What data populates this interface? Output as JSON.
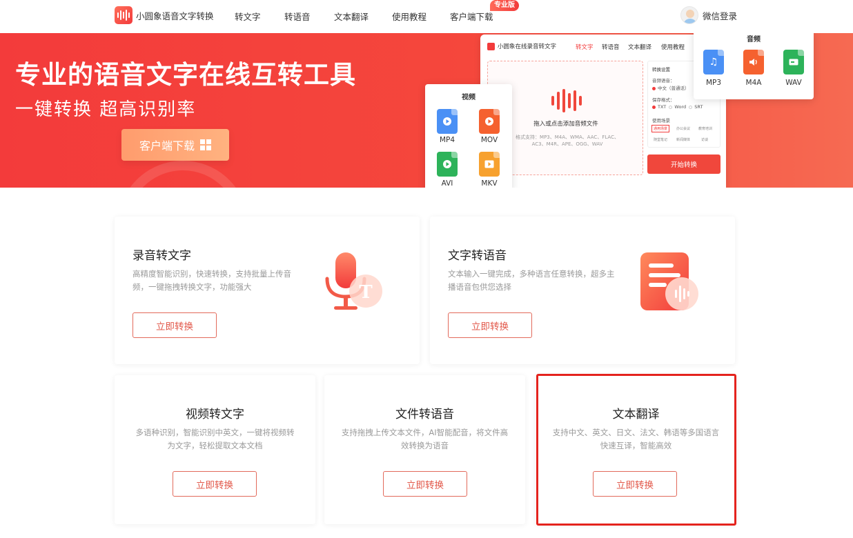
{
  "nav": {
    "brand": "小圆象语音文字转换",
    "items": [
      "转文字",
      "转语音",
      "文本翻译",
      "使用教程",
      "客户端下载"
    ],
    "pro_badge": "专业版",
    "login": "微信登录"
  },
  "hero": {
    "title": "专业的语音文字在线互转工具",
    "subtitle": "一键转换 超高识别率",
    "download_button": "客户端下载"
  },
  "mock_app": {
    "brand": "小圆象在线录音转文字",
    "tabs": [
      "转文字",
      "转语音",
      "文本翻译",
      "使用教程"
    ],
    "drop_title": "拖入或点击添加音频文件",
    "drop_formats": "格式支持：MP3、M4A、WMA、AAC、FLAC、AC3、M4R、APE、OGG、WAV",
    "settings_title": "转换设置",
    "lang_label": "音频语音：",
    "lang_value": "中文（普通话）",
    "save_label": "保存格式：",
    "save_options": [
      "TXT",
      "Word",
      "SRT"
    ],
    "scene_label": "使用场景",
    "scenes": [
      "通用场景",
      "办公会议",
      "教育培训",
      "随堂笔记",
      "新闻媒体",
      "访谈"
    ],
    "start_button": "开始转换"
  },
  "video_formats": {
    "title": "视频",
    "items": [
      {
        "label": "MP4",
        "icon": "mp4-file-icon",
        "color": "#4a90f5"
      },
      {
        "label": "MOV",
        "icon": "mov-file-icon",
        "color": "#f5612f"
      },
      {
        "label": "AVI",
        "icon": "avi-file-icon",
        "color": "#2db35a"
      },
      {
        "label": "MKV",
        "icon": "mkv-file-icon",
        "color": "#f7a12e"
      }
    ]
  },
  "audio_formats": {
    "title": "音频",
    "items": [
      {
        "label": "MP3",
        "icon": "mp3-file-icon",
        "color": "#4a90f5"
      },
      {
        "label": "M4A",
        "icon": "m4a-file-icon",
        "color": "#f5612f"
      },
      {
        "label": "WAV",
        "icon": "wav-file-icon",
        "color": "#2db35a"
      }
    ]
  },
  "cards": [
    {
      "title": "录音转文字",
      "desc": "高精度智能识别，快速转换，支持批量上传音频，一键拖拽转换文字，功能强大",
      "button": "立即转换"
    },
    {
      "title": "文字转语音",
      "desc": "文本输入一键完成，多种语言任意转换，超多主播语音包供您选择",
      "button": "立即转换"
    },
    {
      "title": "视频转文字",
      "desc": "多语种识别，智能识别中英文，一键将视频转为文字，轻松提取文本文档",
      "button": "立即转换"
    },
    {
      "title": "文件转语音",
      "desc": "支持拖拽上传文本文件，AI智能配音，将文件高效转换为语音",
      "button": "立即转换"
    },
    {
      "title": "文本翻译",
      "desc": "支持中文、英文、日文、法文、韩语等多国语言快速互译，智能高效",
      "button": "立即转换"
    }
  ],
  "colors": {
    "brand": "#f23b3b",
    "accent_button": "#e2584a",
    "highlight": "#e4231d"
  }
}
